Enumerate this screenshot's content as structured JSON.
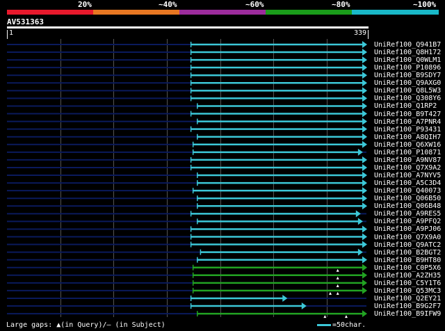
{
  "identity_scale": {
    "labels": [
      "20%",
      "~40%",
      "~60%",
      "~80%",
      "~100%"
    ],
    "colors": [
      "#e8192c",
      "#e87722",
      "#9c2c9c",
      "#1a9c1a",
      "#19b8c8"
    ]
  },
  "query": {
    "id": "AV531363",
    "length": 339,
    "start_label": "1",
    "end_label": "339"
  },
  "colors": {
    "query_line": "#0a1a5c",
    "hit_cyan": "#3cc8d8",
    "hit_green": "#22a322",
    "gap_marker": "#ffffff"
  },
  "hits": [
    {
      "id": "UniRef100_Q941B7",
      "start": 174,
      "end": 339,
      "color": "cyan"
    },
    {
      "id": "UniRef100_Q8H172",
      "start": 174,
      "end": 339,
      "color": "cyan"
    },
    {
      "id": "UniRef100_Q0WLM1",
      "start": 174,
      "end": 339,
      "color": "cyan"
    },
    {
      "id": "UniRef100_P10896",
      "start": 174,
      "end": 339,
      "color": "cyan"
    },
    {
      "id": "UniRef100_B9SDY7",
      "start": 174,
      "end": 339,
      "color": "cyan"
    },
    {
      "id": "UniRef100_Q9AXG0",
      "start": 174,
      "end": 339,
      "color": "cyan"
    },
    {
      "id": "UniRef100_Q8L5W3",
      "start": 174,
      "end": 339,
      "color": "cyan"
    },
    {
      "id": "UniRef100_Q308Y6",
      "start": 174,
      "end": 339,
      "color": "cyan"
    },
    {
      "id": "UniRef100_Q1RP2",
      "start": 180,
      "end": 339,
      "color": "cyan"
    },
    {
      "id": "UniRef100_B9T427",
      "start": 174,
      "end": 339,
      "color": "cyan"
    },
    {
      "id": "UniRef100_A7PNR4",
      "start": 180,
      "end": 339,
      "color": "cyan"
    },
    {
      "id": "UniRef100_P93431",
      "start": 174,
      "end": 339,
      "color": "cyan"
    },
    {
      "id": "UniRef100_A8QIH7",
      "start": 180,
      "end": 339,
      "color": "cyan"
    },
    {
      "id": "UniRef100_Q6XW16",
      "start": 176,
      "end": 339,
      "color": "cyan"
    },
    {
      "id": "UniRef100_P10871",
      "start": 176,
      "end": 335,
      "color": "cyan"
    },
    {
      "id": "UniRef100_A9NV87",
      "start": 174,
      "end": 339,
      "color": "cyan"
    },
    {
      "id": "UniRef100_Q7X9A2",
      "start": 174,
      "end": 339,
      "color": "cyan"
    },
    {
      "id": "UniRef100_A7NYV5",
      "start": 180,
      "end": 339,
      "color": "cyan"
    },
    {
      "id": "UniRef100_A5C3D4",
      "start": 180,
      "end": 339,
      "color": "cyan"
    },
    {
      "id": "UniRef100_Q40073",
      "start": 176,
      "end": 339,
      "color": "cyan"
    },
    {
      "id": "UniRef100_Q06B50",
      "start": 180,
      "end": 339,
      "color": "cyan"
    },
    {
      "id": "UniRef100_Q06B48",
      "start": 180,
      "end": 339,
      "color": "cyan"
    },
    {
      "id": "UniRef100_A9RES5",
      "start": 174,
      "end": 333,
      "color": "cyan"
    },
    {
      "id": "UniRef100_A9PFQ2",
      "start": 180,
      "end": 335,
      "color": "cyan"
    },
    {
      "id": "UniRef100_A9PJ06",
      "start": 174,
      "end": 339,
      "color": "cyan"
    },
    {
      "id": "UniRef100_Q7X9A0",
      "start": 174,
      "end": 339,
      "color": "cyan"
    },
    {
      "id": "UniRef100_Q9ATC2",
      "start": 174,
      "end": 339,
      "color": "cyan"
    },
    {
      "id": "UniRef100_B2BGT2",
      "start": 183,
      "end": 335,
      "color": "cyan"
    },
    {
      "id": "UniRef100_B9HT80",
      "start": 180,
      "end": 339,
      "color": "cyan"
    },
    {
      "id": "UniRef100_C0P5X6",
      "start": 176,
      "end": 339,
      "color": "green",
      "gaps": [
        312
      ]
    },
    {
      "id": "UniRef100_A2ZH35",
      "start": 176,
      "end": 339,
      "color": "green",
      "gaps": [
        312
      ]
    },
    {
      "id": "UniRef100_C5Y1T6",
      "start": 176,
      "end": 339,
      "color": "green",
      "gaps": [
        312
      ]
    },
    {
      "id": "UniRef100_Q53MC3",
      "start": 176,
      "end": 339,
      "color": "green",
      "gaps": [
        305,
        312
      ]
    },
    {
      "id": "UniRef100_Q2EY21",
      "start": 174,
      "end": 264,
      "color": "cyan"
    },
    {
      "id": "UniRef100_B9G2F7",
      "start": 174,
      "end": 282,
      "color": "cyan"
    },
    {
      "id": "UniRef100_B9IFW9",
      "start": 180,
      "end": 339,
      "color": "green",
      "gaps": [
        300,
        320
      ]
    }
  ],
  "legend": {
    "gaps_text": "Large gaps: ▲(in Query)/— (in Subject)",
    "scale_text": "=50char."
  }
}
